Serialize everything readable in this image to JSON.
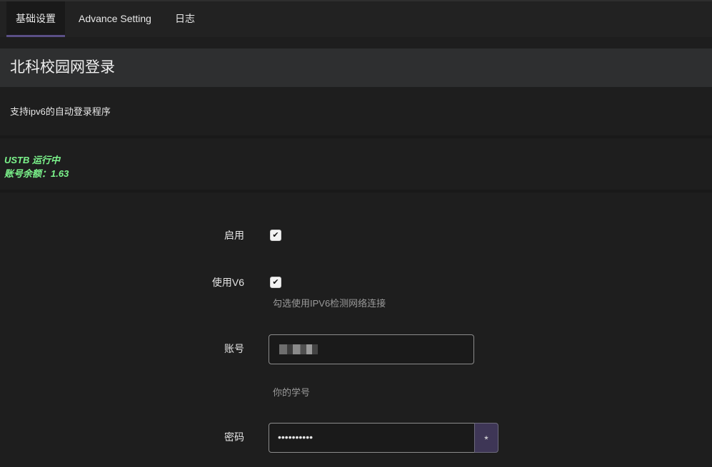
{
  "tabs": [
    {
      "label": "基础设置",
      "active": true
    },
    {
      "label": "Advance Setting",
      "active": false
    },
    {
      "label": "日志",
      "active": false
    }
  ],
  "page": {
    "title": "北科校园网登录",
    "description": "支持ipv6的自动登录程序"
  },
  "status": {
    "running": "USTB 运行中",
    "balance": "账号余额：1.63"
  },
  "form": {
    "enable": {
      "label": "启用",
      "checked": true
    },
    "use_v6": {
      "label": "使用V6",
      "checked": true,
      "help": "勾选使用IPV6检测网络连接"
    },
    "account": {
      "label": "账号",
      "help": "你的学号"
    },
    "password": {
      "label": "密码",
      "value": "••••••••••",
      "reveal_label": "*"
    }
  },
  "colors": {
    "accent": "#5a4f86",
    "status_green": "#7cf58c"
  }
}
